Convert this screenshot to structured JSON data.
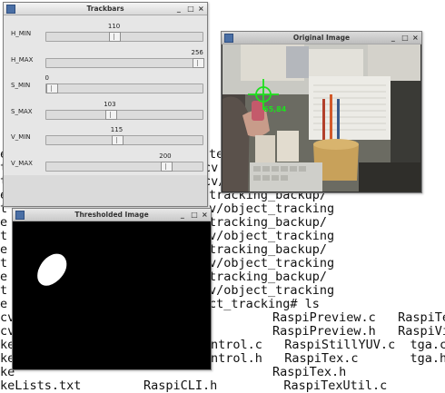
{
  "terminal": {
    "lines": [
      "",
      "tes",
      "cv",
      "cv/",
      "tracking_backup/",
      "v/object_tracking",
      "tracking_backup/",
      "v/object_tracking",
      "tracking_backup/",
      "v/object_tracking",
      "tracking_backup/",
      "v/object_tracking",
      "ct_tracking# ls",
      "RaspiPreview.c   RaspiTex",
      "RaspiPreview.h   RaspiVid",
      "ntrol.c   RaspiStillYUV.c  tga.c",
      "ntrol.h   RaspiTex.c       tga.h",
      "RaspiTex.h",
      "RaspiCLI.h         RaspiTexUtil.c"
    ],
    "left_col": [
      "E",
      "e",
      "t",
      "t",
      "e",
      "t",
      "e",
      "t",
      "e",
      "t",
      "e",
      "t",
      "e",
      "cv",
      "cv",
      "ke",
      "ke",
      "ke",
      "keLists.txt"
    ]
  },
  "trackbars_window": {
    "title": "Trackbars",
    "buttons": [
      "_",
      "□",
      "×"
    ],
    "sliders": [
      {
        "label": "H_MIN",
        "value": "110",
        "fraction": 0.431
      },
      {
        "label": "H_MAX",
        "value": "256",
        "fraction": 1.0
      },
      {
        "label": "S_MIN",
        "value": "0",
        "fraction": 0.0
      },
      {
        "label": "S_MAX",
        "value": "103",
        "fraction": 0.402
      },
      {
        "label": "V_MIN",
        "value": "115",
        "fraction": 0.449
      },
      {
        "label": "V_MAX",
        "value": "200",
        "fraction": 0.781
      }
    ]
  },
  "original_window": {
    "title": "Original Image",
    "buttons": [
      "_",
      "□",
      "×"
    ],
    "target_label": "65,84",
    "crosshair_color": "#1ee01e"
  },
  "thresholded_window": {
    "title": "Thresholded Image",
    "buttons": [
      "_",
      "□",
      "×"
    ]
  }
}
